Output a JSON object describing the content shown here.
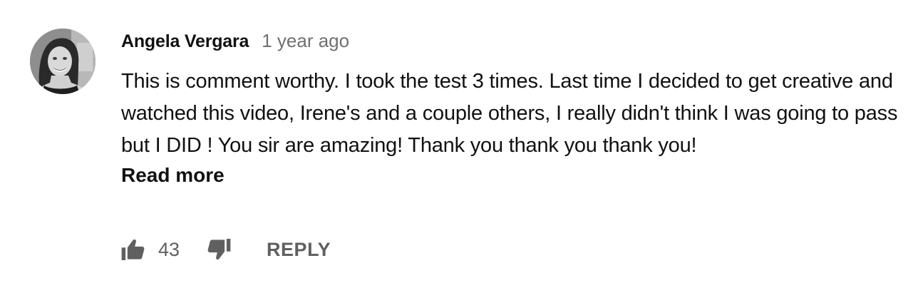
{
  "comment": {
    "author": "Angela Vergara",
    "time": "1 year ago",
    "text": "This is comment worthy. I took the test 3 times. Last time I decided to get creative and watched this video, Irene's and a couple others, I really didn't think I was going to pass but I DID ! You sir are amazing! Thank you thank you thank you!",
    "read_more_label": "Read more",
    "avatar_icon": "user-avatar-photo"
  },
  "actions": {
    "like_icon": "thumbs-up-icon",
    "like_count": "43",
    "dislike_icon": "thumbs-down-icon",
    "reply_label": "REPLY"
  },
  "colors": {
    "primary_text": "#111111",
    "secondary_text": "#707070",
    "icon": "#606060",
    "background": "#ffffff"
  }
}
